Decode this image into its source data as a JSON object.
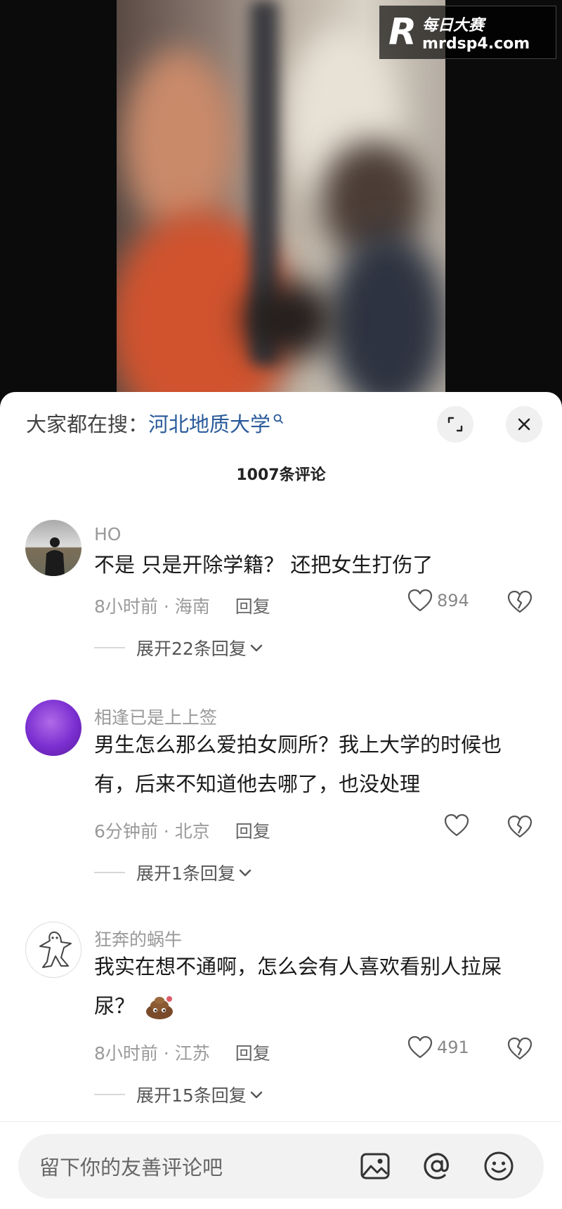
{
  "watermark": {
    "logo": "R",
    "line1": "每日大赛",
    "line2": "mrdsp4.com"
  },
  "search": {
    "prefix": "大家都在搜：",
    "term": "河北地质大学"
  },
  "comments_header": {
    "count_label": "1007条评论"
  },
  "comments": [
    {
      "username": "HO",
      "text": "不是 只是开除学籍？ 还把女生打伤了",
      "time_location": "8小时前 · 海南",
      "reply_label": "回复",
      "likes": "894",
      "expand_label": "展开22条回复"
    },
    {
      "username": "相逢已是上上签",
      "text": "男生怎么那么爱拍女厕所？我上大学的时候也有，后来不知道他去哪了，也没处理",
      "time_location": "6分钟前 · 北京",
      "reply_label": "回复",
      "likes": "",
      "expand_label": "展开1条回复"
    },
    {
      "username": "狂奔的蜗牛",
      "text": "我实在想不通啊，怎么会有人喜欢看别人拉屎尿？",
      "time_location": "8小时前 · 江苏",
      "reply_label": "回复",
      "likes": "491",
      "expand_label": "展开15条回复"
    }
  ],
  "input": {
    "placeholder": "留下你的友善评论吧"
  },
  "icons": {
    "expand": "expand-icon",
    "close": "close-icon",
    "heart": "heart-icon",
    "broken_heart": "broken-heart-icon",
    "chevron": "chevron-down-icon",
    "image": "image-icon",
    "mention": "at-icon",
    "emoji": "emoji-icon",
    "poop": "poop-emoji-icon"
  },
  "colors": {
    "search_link": "#2a5a9a",
    "meta_gray": "#9a9a9a",
    "sheet_bg": "#ffffff"
  }
}
